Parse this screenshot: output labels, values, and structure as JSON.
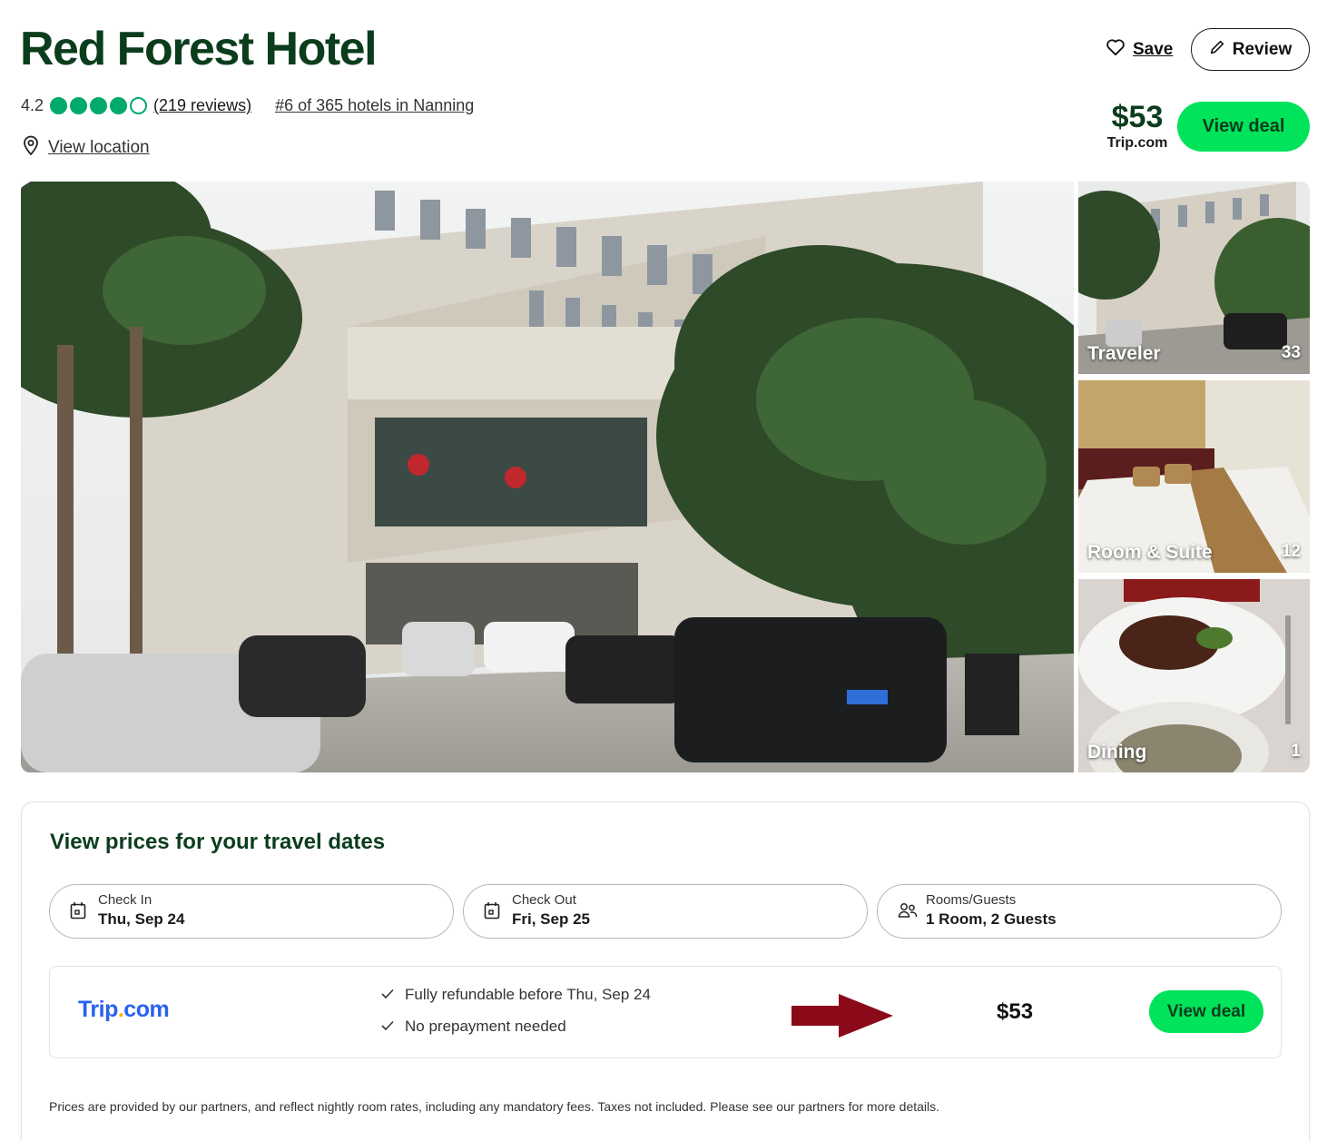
{
  "hotel": {
    "name": "Red Forest Hotel",
    "rating": "4.2",
    "rating_bubbles": 4,
    "bubbles_total": 5,
    "reviews_label": "(219 reviews)",
    "rank_label": "#6 of 365 hotels in Nanning",
    "location_label": "View location"
  },
  "actions": {
    "save_label": "Save",
    "review_label": "Review"
  },
  "top_offer": {
    "price": "$53",
    "provider": "Trip.com",
    "deal_label": "View deal"
  },
  "gallery": {
    "thumbnails": [
      {
        "caption": "Traveler",
        "count": "33"
      },
      {
        "caption": "Room & Suite",
        "count": "12"
      },
      {
        "caption": "Dining",
        "count": "1"
      }
    ]
  },
  "pricing": {
    "title": "View prices for your travel dates",
    "check_in": {
      "label": "Check In",
      "value": "Thu, Sep 24"
    },
    "check_out": {
      "label": "Check Out",
      "value": "Fri, Sep 25"
    },
    "guests": {
      "label": "Rooms/Guests",
      "value": "1 Room, 2 Guests"
    },
    "offer": {
      "provider_main": "Trip",
      "provider_dot": ".",
      "provider_tld": "com",
      "features": [
        "Fully refundable before Thu, Sep 24",
        "No prepayment needed"
      ],
      "price": "$53",
      "deal_label": "View deal"
    },
    "disclaimer": "Prices are provided by our partners, and reflect nightly room rates, including any mandatory fees. Taxes not included. Please see our partners for more details."
  },
  "colors": {
    "accent_green": "#00e35a",
    "title_green": "#0b3d1d",
    "bubble_green": "#00aa6c",
    "trip_blue": "#2862f0",
    "arrow_red": "#8b0a1a"
  }
}
